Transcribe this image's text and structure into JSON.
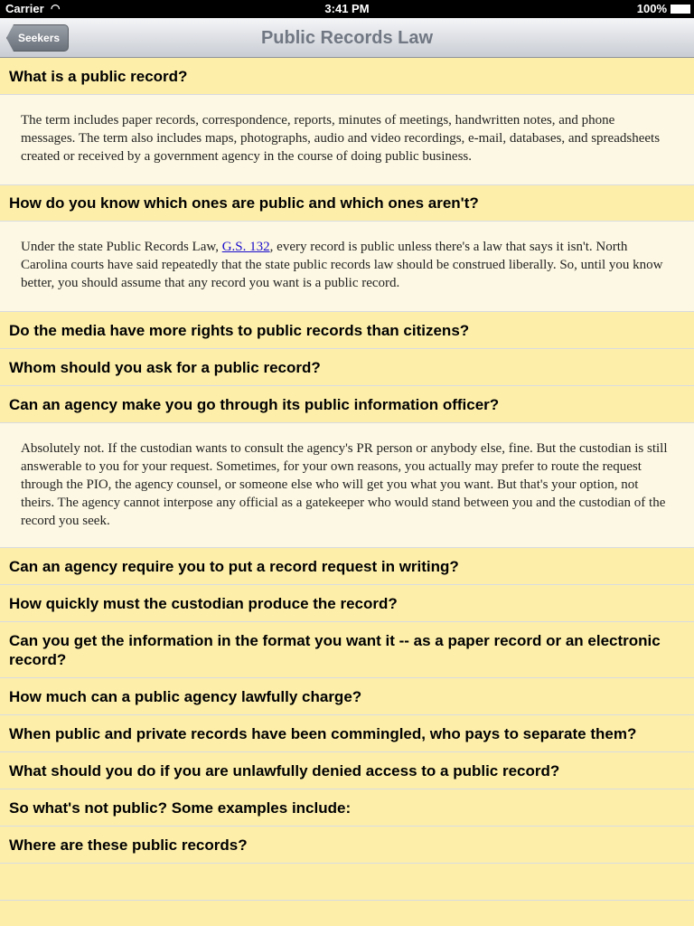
{
  "status": {
    "carrier": "Carrier",
    "time": "3:41 PM",
    "battery": "100%"
  },
  "nav": {
    "back": "Seekers",
    "title": "Public Records Law"
  },
  "faq": [
    {
      "q": "What is a public record?",
      "a": "The term includes paper records, correspondence, reports, minutes of meetings, handwritten notes, and phone messages. The term also includes maps, photographs, audio and video recordings, e-mail, databases, and spreadsheets created or received by a government agency in the course of doing public business."
    },
    {
      "q": "How do you know which ones are public and which ones aren't?",
      "a_pre": "Under the state Public Records Law, ",
      "a_link": "G.S. 132",
      "a_post": ", every record is public unless there's a law that says it isn't. North Carolina courts have said repeatedly that the state public records law should be construed liberally. So, until you know better, you should assume that any record you want is a public record."
    },
    {
      "q": "Do the media have more rights to public records than citizens?"
    },
    {
      "q": "Whom should you ask for a public record?"
    },
    {
      "q": "Can an agency make you go through its public information officer?",
      "a": "Absolutely not. If the custodian wants to consult the agency's PR person or anybody else, fine. But the custodian is still answerable to you for your request. Sometimes, for your own reasons, you actually may prefer to route the request through the PIO, the agency counsel, or someone else who will get you what you want. But that's your option, not theirs. The agency cannot interpose any official as a gatekeeper who would stand between you and the custodian of the record you seek."
    },
    {
      "q": "Can an agency require you to put a record request in writing?"
    },
    {
      "q": "How quickly must the custodian produce the record?"
    },
    {
      "q": "Can you get the information in the format you want it -- as a paper record or an electronic record?"
    },
    {
      "q": "How much can a public agency lawfully charge?"
    },
    {
      "q": "When public and private records have been commingled, who pays to separate them?"
    },
    {
      "q": "What should you do if you are unlawfully denied access to a public record?"
    },
    {
      "q": "So what's not public? Some examples include:"
    },
    {
      "q": "Where are these public records?"
    }
  ]
}
